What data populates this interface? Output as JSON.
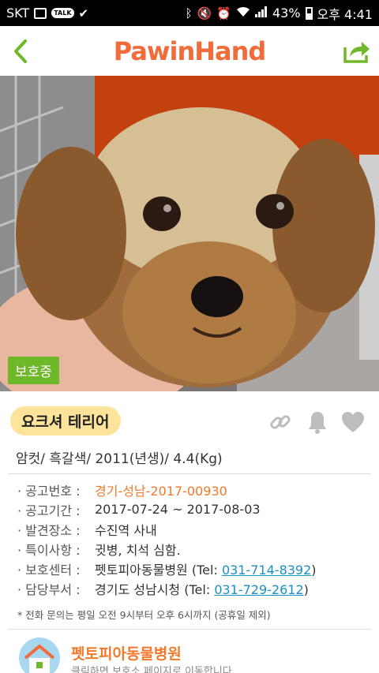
{
  "status_bar": {
    "carrier": "SKT",
    "talk_badge": "TALK",
    "battery": "43%",
    "time": "오후 4:41"
  },
  "header": {
    "logo": "PawinHand"
  },
  "photo": {
    "status_tag": "보호중"
  },
  "animal": {
    "breed": "요크셔 테리어",
    "summary": "암컷/ 흑갈색/ 2011(년생)/ 4.4(Kg)"
  },
  "details": {
    "notice_no_label": "공고번호 :",
    "notice_no": "경기-성남-2017-00930",
    "period_label": "공고기간 :",
    "period": "2017-07-24 ~ 2017-08-03",
    "found_label": "발견장소 :",
    "found": "수진역 사내",
    "special_label": "특이사항 :",
    "special": "귓병, 치석 심함.",
    "center_label": "보호센터 :",
    "center_name": "펫토피아동물병원",
    "center_tel_prefix": "(Tel:",
    "center_tel": "031-714-8392",
    "center_tel_suffix": ")",
    "dept_label": "담당부서 :",
    "dept_name": "경기도 성남시청",
    "dept_tel_prefix": "(Tel:",
    "dept_tel": "031-729-2612",
    "dept_tel_suffix": ")",
    "note": "* 전화 문의는 평일 오전 9시부터 오후 6시까지 (공휴일 제외)"
  },
  "hospital": {
    "name": "펫토피아동물병원",
    "desc": "클릭하면 보호소 페이지로 이동합니다"
  },
  "colors": {
    "brand": "#f26b3a",
    "accent_green": "#6fb82a",
    "link": "#1a8fc4",
    "breed_pill": "#fde49a"
  }
}
